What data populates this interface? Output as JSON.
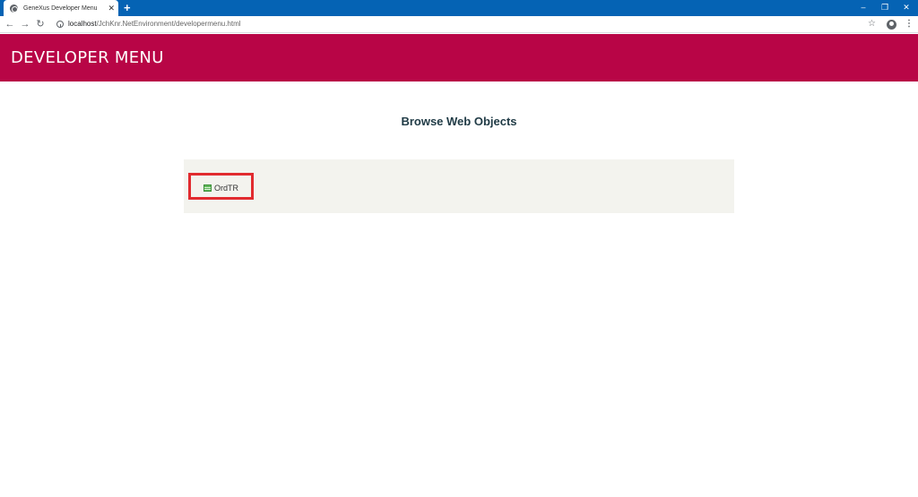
{
  "browser": {
    "tab_title": "GeneXus Developer Menu",
    "tab_close": "✕",
    "new_tab": "+",
    "url_host": "localhost",
    "url_path": "/JchKnr.NetEnvironment/developermenu.html",
    "window_minimize": "–",
    "window_restore": "❐",
    "window_close": "✕"
  },
  "page": {
    "header_title": "DEVELOPER MENU",
    "section_title": "Browse Web Objects",
    "objects": [
      {
        "label": "OrdTR",
        "icon": "transaction-icon"
      }
    ]
  },
  "colors": {
    "titlebar": "#0563b4",
    "header_banner": "#b80546",
    "panel": "#f3f3ee",
    "highlight_border": "#e12b2f"
  }
}
